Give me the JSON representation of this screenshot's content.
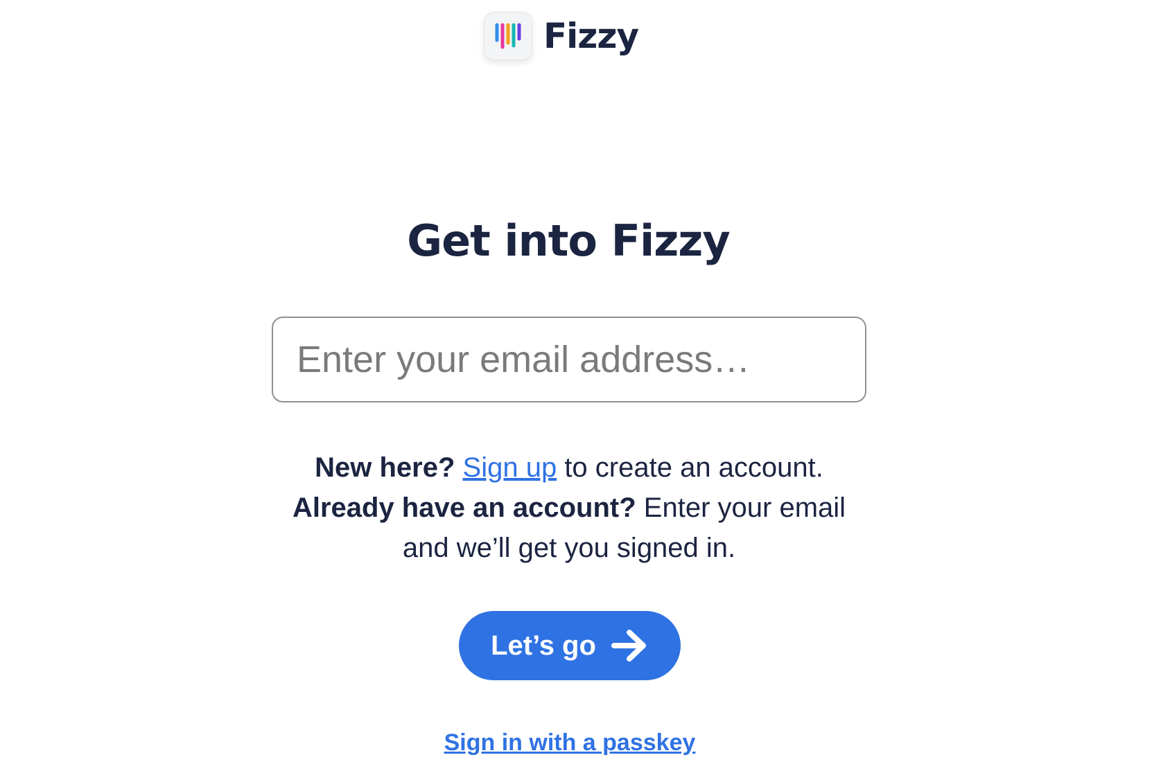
{
  "brand": {
    "name": "Fizzy",
    "logo_icon": "fizzy-logo-icon",
    "logo_colors": [
      "#2f8fe8",
      "#e8379b",
      "#f2a21b",
      "#19b7b2",
      "#6b3fe0"
    ]
  },
  "heading": "Get into Fizzy",
  "email": {
    "placeholder": "Enter your email address…",
    "value": ""
  },
  "help": {
    "new_here": "New here?",
    "sign_up": "Sign up",
    "create_account": " to create an account.",
    "already": "Already have an account?",
    "already_rest": " Enter your email and we’ll get you signed in."
  },
  "cta": {
    "label": "Let’s go",
    "icon": "arrow-right-icon"
  },
  "passkey": {
    "label": "Sign in with a passkey"
  },
  "colors": {
    "accent": "#2f72e3",
    "text": "#1b2440",
    "placeholder": "#7a7a7a"
  }
}
